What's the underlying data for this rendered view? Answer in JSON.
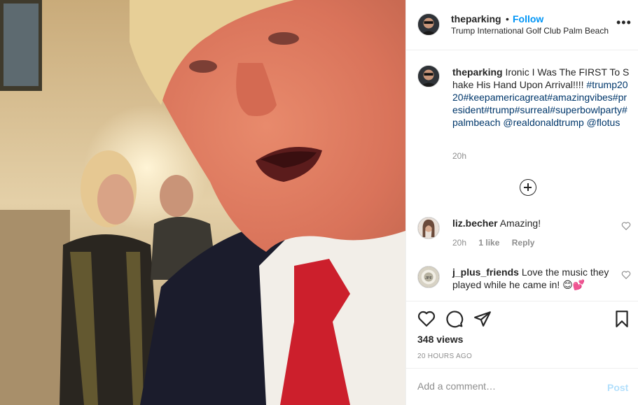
{
  "header": {
    "username": "theparking",
    "separator": "•",
    "follow_label": "Follow",
    "location": "Trump International Golf Club Palm Beach",
    "more_icon": "more-horizontal-icon"
  },
  "caption": {
    "username": "theparking",
    "text": "Ironic I Was The FIRST To Shake His Hand Upon Arrival!!!!",
    "tags": "#trump2020#keepamericagreat#amazingvibes#president#trump#surreal#superbowlparty#palmbeach",
    "mentions": "@realdonaldtrump @flotus",
    "time": "20h"
  },
  "comments": [
    {
      "username": "liz.becher",
      "text": "Amazing!",
      "time": "20h",
      "likes": "1 like",
      "reply": "Reply"
    },
    {
      "username": "j_plus_friends",
      "text": "Love the music they played while he came in! 😊💕"
    }
  ],
  "stats": {
    "views": "348 views",
    "posted": "20 HOURS AGO"
  },
  "composer": {
    "placeholder": "Add a comment…",
    "post_label": "Post"
  },
  "colors": {
    "accent": "#0095f6",
    "hashtag": "#00376b",
    "muted": "#8e8e8e",
    "post_disabled": "#b2dffc"
  }
}
